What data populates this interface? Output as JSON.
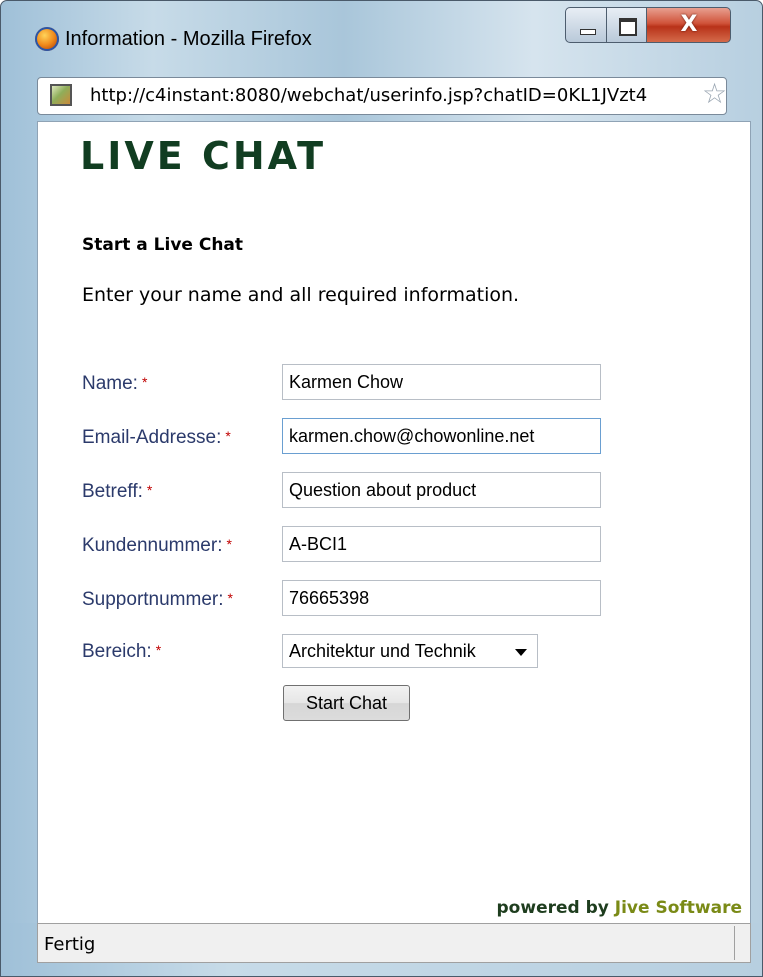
{
  "window": {
    "title": "Information - Mozilla Firefox",
    "controls": {
      "minimize": "–",
      "maximize": "□",
      "close": "X"
    }
  },
  "urlbar": {
    "url": "http://c4instant:8080/webchat/userinfo.jsp?chatID=0KL1JVzt4",
    "icons": [
      "site-favicon-icon",
      "bookmark-star-icon"
    ]
  },
  "page": {
    "logo": "LIVE CHAT",
    "heading": "Start a Live Chat",
    "intro": "Enter your name and all required information.",
    "required_marker": "*",
    "fields": [
      {
        "label": "Name:",
        "value": "Karmen Chow"
      },
      {
        "label": "Email-Addresse:",
        "value": "karmen.chow@chowonline.net"
      },
      {
        "label": "Betreff:",
        "value": "Question about product"
      },
      {
        "label": "Kundennummer:",
        "value": "A-BCI1"
      },
      {
        "label": "Supportnummer:",
        "value": "76665398"
      }
    ],
    "select_field": {
      "label": "Bereich:",
      "value": "Architektur und Technik"
    },
    "submit_label": "Start Chat",
    "powered_prefix": "powered by",
    "powered_brand": "Jive Software"
  },
  "statusbar": {
    "text": "Fertig"
  },
  "colors": {
    "logo": "#113d21",
    "label": "#2b3a6b",
    "required": "#c00000",
    "brand": "#7a8a16"
  }
}
